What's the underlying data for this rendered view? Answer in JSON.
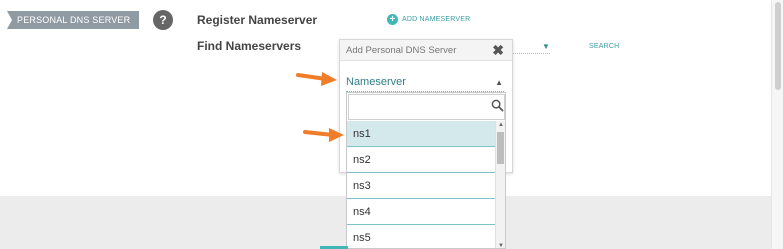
{
  "page": {
    "section_tag": "PERSONAL DNS SERVER",
    "help_icon": "?",
    "register_label": "Register Nameserver",
    "add_nameserver_label": "ADD NAMESERVER",
    "find_label": "Find Nameservers",
    "search_label": "SEARCH"
  },
  "modal": {
    "title": "Add Personal DNS Server",
    "close_glyph": "✖"
  },
  "nameserver_select": {
    "selected_value": "Nameserver",
    "caret_glyph": "▲"
  },
  "dropdown": {
    "search_value": "",
    "options": [
      "ns1",
      "ns2",
      "ns3",
      "ns4",
      "ns5"
    ],
    "highlighted_option": "ns1"
  },
  "icons": {
    "help": "question-mark-icon",
    "add": "plus-circle-icon",
    "close": "close-icon",
    "search": "search-icon",
    "annotation": "orange-arrow-icon"
  },
  "colors": {
    "accent": "#3fb7b7",
    "arrow": "#f07d2a",
    "highlight": "#d3e9ec",
    "tag_bg": "#8f9aa3"
  }
}
